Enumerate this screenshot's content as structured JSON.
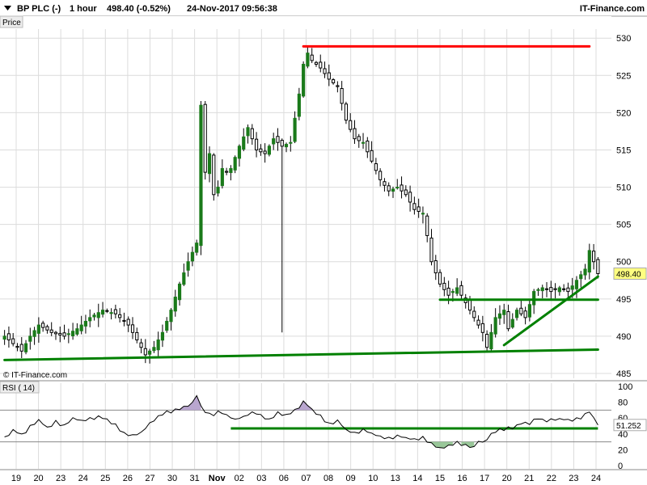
{
  "header": {
    "instrument": "BP PLC (-)",
    "interval": "1 hour",
    "quote": "498.40 (-0.52%)",
    "datetime": "24-Nov-2017 09:56:38",
    "brand": "IT-Finance.com"
  },
  "price_panel": {
    "label": "Price",
    "watermark": "© IT-Finance.com",
    "last_price_tag": "498.40"
  },
  "rsi_panel": {
    "label": "RSI ( 14)",
    "value_tag": "51.252"
  },
  "colors": {
    "up_candle": "#1a7a1a",
    "down_candle": "#000000",
    "resistance_line": "#ff0000",
    "support_lines": "#008000",
    "price_tag_bg": "#ffff80",
    "rsi_overbought_fill": "#b9a6cf",
    "rsi_oversold_fill": "#99c799",
    "grid": "#dcdcdc"
  },
  "chart_data": [
    {
      "type": "candlestick",
      "title": "BP PLC (-) 1 hour",
      "ylim": [
        485,
        531
      ],
      "y_ticks": [
        485,
        490,
        495,
        500,
        505,
        510,
        515,
        520,
        525,
        530
      ],
      "x_tick_labels": [
        "19",
        "20",
        "23",
        "24",
        "25",
        "26",
        "27",
        "30",
        "31",
        "Nov",
        "02",
        "03",
        "06",
        "07",
        "08",
        "09",
        "10",
        "13",
        "14",
        "15",
        "16",
        "17",
        "20",
        "21",
        "22",
        "23",
        "24"
      ],
      "grid": true,
      "close_path": [
        [
          0,
          490.0
        ],
        [
          2,
          489.0
        ],
        [
          4,
          488.0
        ],
        [
          6,
          490.0
        ],
        [
          8,
          491.5
        ],
        [
          11,
          490.5
        ],
        [
          14,
          490.0
        ],
        [
          17,
          491.0
        ],
        [
          20,
          492.5
        ],
        [
          23,
          493.5
        ],
        [
          26,
          493.0
        ],
        [
          29,
          491.5
        ],
        [
          31,
          489.5
        ],
        [
          33,
          487.5
        ],
        [
          35,
          488.5
        ],
        [
          37,
          490.5
        ],
        [
          39,
          493.5
        ],
        [
          41,
          497.0
        ],
        [
          43,
          500.0
        ],
        [
          45,
          502.5
        ],
        [
          46,
          521.0
        ],
        [
          47,
          512.0
        ],
        [
          48,
          514.5
        ],
        [
          49,
          509.0
        ],
        [
          50,
          510.0
        ],
        [
          51,
          512.5
        ],
        [
          52,
          512.0
        ],
        [
          53,
          512.5
        ],
        [
          55,
          515.5
        ],
        [
          57,
          518.0
        ],
        [
          59,
          515.0
        ],
        [
          61,
          514.5
        ],
        [
          63,
          516.5
        ],
        [
          65,
          515.5
        ],
        [
          67,
          516.0
        ],
        [
          69,
          522.5
        ],
        [
          70,
          526.5
        ],
        [
          71,
          528.0
        ],
        [
          72,
          527.0
        ],
        [
          74,
          526.0
        ],
        [
          76,
          524.5
        ],
        [
          78,
          523.5
        ],
        [
          80,
          519.0
        ],
        [
          82,
          516.5
        ],
        [
          84,
          516.0
        ],
        [
          86,
          513.5
        ],
        [
          88,
          511.0
        ],
        [
          90,
          509.5
        ],
        [
          92,
          510.0
        ],
        [
          94,
          509.0
        ],
        [
          96,
          507.0
        ],
        [
          98,
          506.5
        ],
        [
          99,
          503.5
        ],
        [
          100,
          500.0
        ],
        [
          102,
          497.0
        ],
        [
          104,
          495.5
        ],
        [
          106,
          496.5
        ],
        [
          108,
          494.5
        ],
        [
          110,
          492.5
        ],
        [
          112,
          490.5
        ],
        [
          113,
          488.5
        ],
        [
          115,
          492.5
        ],
        [
          117,
          493.5
        ],
        [
          118,
          491.0
        ],
        [
          120,
          493.5
        ],
        [
          122,
          492.5
        ],
        [
          124,
          496.0
        ],
        [
          126,
          496.5
        ],
        [
          128,
          496.0
        ],
        [
          130,
          496.5
        ],
        [
          132,
          496.0
        ],
        [
          134,
          497.5
        ],
        [
          136,
          499.0
        ],
        [
          137,
          501.5
        ],
        [
          138,
          500.0
        ],
        [
          139,
          498.4
        ]
      ],
      "wick_overrides": [
        [
          65,
          490.5,
          516.0
        ]
      ],
      "trend_lines": [
        {
          "from": [
            0,
            486.8
          ],
          "to": [
            139,
            488.2
          ],
          "color": "support_lines"
        },
        {
          "from": [
            102,
            494.9
          ],
          "to": [
            139,
            494.9
          ],
          "color": "support_lines"
        },
        {
          "from": [
            117,
            488.8
          ],
          "to": [
            139,
            498.0
          ],
          "color": "support_lines"
        },
        {
          "from": [
            70,
            528.9
          ],
          "to": [
            137,
            528.9
          ],
          "color": "resistance_line"
        }
      ]
    },
    {
      "type": "line",
      "title": "RSI ( 14)",
      "ylim": [
        0,
        100
      ],
      "y_ticks": [
        0,
        20,
        40,
        60,
        80,
        100
      ],
      "grid": true,
      "overbought": 70,
      "oversold": 30,
      "series": [
        {
          "values": [
            [
              0,
              35
            ],
            [
              2,
              45
            ],
            [
              4,
              38
            ],
            [
              6,
              49
            ],
            [
              8,
              58
            ],
            [
              10,
              48
            ],
            [
              12,
              55
            ],
            [
              14,
              50
            ],
            [
              16,
              60
            ],
            [
              18,
              57
            ],
            [
              20,
              59
            ],
            [
              22,
              62
            ],
            [
              24,
              57
            ],
            [
              26,
              52
            ],
            [
              28,
              40
            ],
            [
              30,
              38
            ],
            [
              32,
              42
            ],
            [
              34,
              52
            ],
            [
              36,
              62
            ],
            [
              38,
              67
            ],
            [
              40,
              70
            ],
            [
              42,
              74
            ],
            [
              44,
              78
            ],
            [
              45,
              89
            ],
            [
              46,
              75
            ],
            [
              47,
              68
            ],
            [
              48,
              66
            ],
            [
              49,
              64
            ],
            [
              50,
              68
            ],
            [
              52,
              64
            ],
            [
              54,
              58
            ],
            [
              56,
              62
            ],
            [
              58,
              66
            ],
            [
              60,
              64
            ],
            [
              62,
              58
            ],
            [
              64,
              67
            ],
            [
              66,
              63
            ],
            [
              68,
              69
            ],
            [
              70,
              80
            ],
            [
              71,
              77
            ],
            [
              72,
              70
            ],
            [
              74,
              62
            ],
            [
              76,
              52
            ],
            [
              78,
              57
            ],
            [
              80,
              45
            ],
            [
              82,
              40
            ],
            [
              84,
              46
            ],
            [
              86,
              41
            ],
            [
              88,
              37
            ],
            [
              90,
              34
            ],
            [
              92,
              37
            ],
            [
              94,
              35
            ],
            [
              96,
              32
            ],
            [
              98,
              36
            ],
            [
              100,
              27
            ],
            [
              102,
              22
            ],
            [
              104,
              26
            ],
            [
              106,
              29
            ],
            [
              108,
              25
            ],
            [
              110,
              23
            ],
            [
              111,
              32
            ],
            [
              112,
              28
            ],
            [
              113,
              34
            ],
            [
              115,
              44
            ],
            [
              117,
              46
            ],
            [
              119,
              48
            ],
            [
              121,
              54
            ],
            [
              123,
              54
            ],
            [
              125,
              61
            ],
            [
              127,
              56
            ],
            [
              129,
              58
            ],
            [
              131,
              58
            ],
            [
              133,
              58
            ],
            [
              135,
              61
            ],
            [
              137,
              68
            ],
            [
              139,
              51.25
            ]
          ]
        }
      ],
      "trend_lines": [
        {
          "from": [
            53,
            47
          ],
          "to": [
            139,
            47
          ],
          "color": "support_lines"
        }
      ]
    }
  ]
}
